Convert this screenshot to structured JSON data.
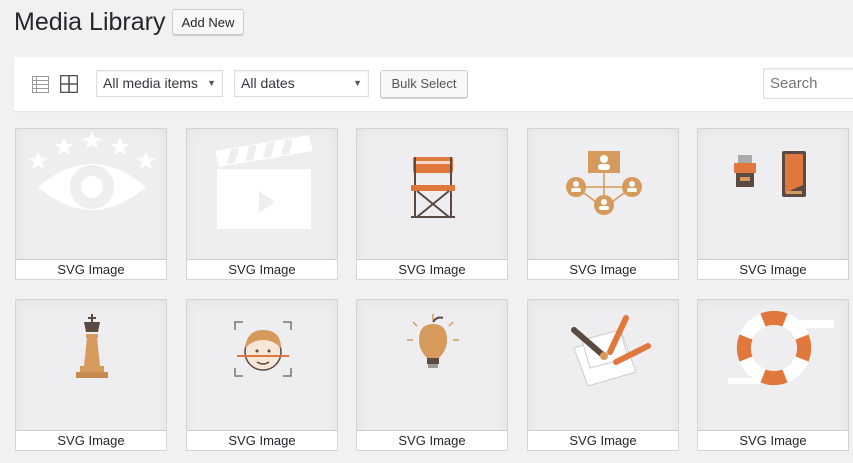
{
  "page": {
    "title": "Media Library",
    "add_new_label": "Add New"
  },
  "toolbar": {
    "media_filter": "All media items",
    "date_filter": "All dates",
    "bulk_select_label": "Bulk Select",
    "search_placeholder": "Search"
  },
  "colors": {
    "accent_orange": "#e0783e",
    "tan": "#d69a5c",
    "bg": "#f1f1f1"
  },
  "media": [
    {
      "caption": "SVG Image",
      "icon": "eye-stars-icon"
    },
    {
      "caption": "SVG Image",
      "icon": "clapperboard-icon"
    },
    {
      "caption": "SVG Image",
      "icon": "director-chair-icon"
    },
    {
      "caption": "SVG Image",
      "icon": "network-users-icon"
    },
    {
      "caption": "SVG Image",
      "icon": "devices-icon"
    },
    {
      "caption": "SVG Image",
      "icon": "chess-queen-icon"
    },
    {
      "caption": "SVG Image",
      "icon": "face-scan-icon"
    },
    {
      "caption": "SVG Image",
      "icon": "lightbulb-apple-icon"
    },
    {
      "caption": "SVG Image",
      "icon": "pencils-paper-icon"
    },
    {
      "caption": "SVG Image",
      "icon": "lifebuoy-icon"
    }
  ]
}
